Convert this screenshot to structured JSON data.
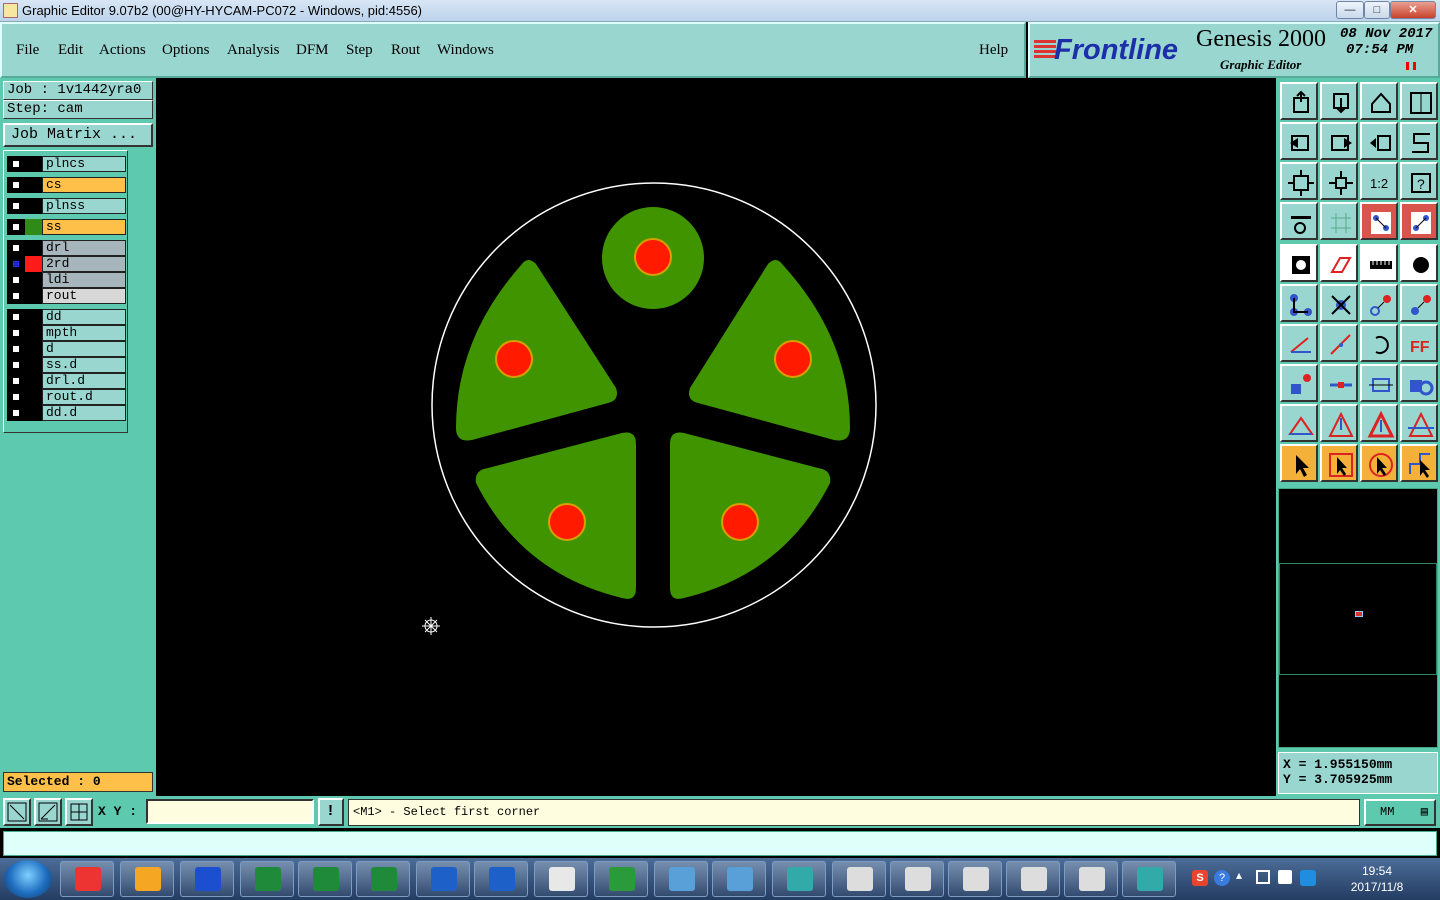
{
  "window": {
    "title": "Graphic Editor 9.07b2 (00@HY-HYCAM-PC072 - Windows, pid:4556)",
    "controls": [
      "—",
      "□",
      "✕"
    ]
  },
  "menu": {
    "items": [
      "File",
      "Edit",
      "Actions",
      "Options",
      "Analysis",
      "DFM",
      "Step",
      "Rout",
      "Windows"
    ],
    "help": "Help"
  },
  "branding": {
    "logo": "Frontline",
    "product": "Genesis 2000",
    "subtitle": "Graphic Editor",
    "date": "08 Nov 2017",
    "time": "07:54 PM"
  },
  "left": {
    "job": "Job : 1v1442yra0",
    "step": "Step: cam",
    "job_matrix": "Job Matrix ...",
    "selected": "Selected : 0"
  },
  "layers": [
    {
      "name": "plncs",
      "swatch": "#000000",
      "bg": "#9ad6d0",
      "marked": false
    },
    {
      "name": "cs",
      "swatch": "#000000",
      "bg": "#ffc04a",
      "marked": false
    },
    {
      "name": "plnss",
      "swatch": "#000000",
      "bg": "#9ad6d0",
      "marked": false
    },
    {
      "name": "ss",
      "swatch": "#2f8a1a",
      "bg": "#ffc04a",
      "marked": false
    },
    {
      "name": "drl",
      "swatch": "#000000",
      "bg": "#a7b6bd",
      "marked": false
    },
    {
      "name": "2rd",
      "swatch": "#ff1a1a",
      "bg": "#a7b6bd",
      "marked": true
    },
    {
      "name": "ldi",
      "swatch": "#000000",
      "bg": "#a7b6bd",
      "marked": false
    },
    {
      "name": "rout",
      "swatch": "#000000",
      "bg": "#d8d8d8",
      "marked": false
    },
    {
      "name": "dd",
      "swatch": "#000000",
      "bg": "#9ad6d0",
      "marked": false
    },
    {
      "name": "mpth",
      "swatch": "#000000",
      "bg": "#9ad6d0",
      "marked": false
    },
    {
      "name": "d",
      "swatch": "#000000",
      "bg": "#9ad6d0",
      "marked": false
    },
    {
      "name": "ss.d",
      "swatch": "#000000",
      "bg": "#9ad6d0",
      "marked": false
    },
    {
      "name": "drl.d",
      "swatch": "#000000",
      "bg": "#9ad6d0",
      "marked": false
    },
    {
      "name": "rout.d",
      "swatch": "#000000",
      "bg": "#9ad6d0",
      "marked": false
    },
    {
      "name": "dd.d",
      "swatch": "#000000",
      "bg": "#9ad6d0",
      "marked": false
    }
  ],
  "coords": {
    "x": "X = 1.955150mm",
    "y": "Y = 3.705925mm"
  },
  "bottom": {
    "xy_label": "X Y :",
    "xy_value": "",
    "prompt": "<M1> - Select first corner",
    "units": "MM"
  },
  "clock": {
    "time": "19:54",
    "date": "2017/11/8"
  },
  "colors": {
    "panel": "#5dc9ae",
    "button": "#9ad6d0",
    "copper": "#3f9400",
    "pad": "#ff1a00",
    "pad_ring": "#d6a000"
  },
  "toolbar_icons": [
    "open-icon",
    "save-icon",
    "home-icon",
    "window-icon",
    "prev-icon",
    "next-icon",
    "swap-icon",
    "snake-icon",
    "fit-icon",
    "zoom-icon",
    "ratio-icon",
    "help-icon",
    "tools-icon",
    "grid-icon",
    "layers-red-icon",
    "layers-red2-icon",
    "shape-icon",
    "edit-icon",
    "measure-icon",
    "pad-icon",
    "connect-icon",
    "cross-icon",
    "snap-icon",
    "snap2-icon",
    "line-icon",
    "line2-icon",
    "undo-icon",
    "flip-icon",
    "move-icon",
    "minus-icon",
    "resize-icon",
    "copy-icon",
    "tri-icon",
    "tri2-icon",
    "tri3-icon",
    "tri4-icon",
    "arrow-icon",
    "select-icon",
    "select2-icon",
    "route-icon"
  ]
}
